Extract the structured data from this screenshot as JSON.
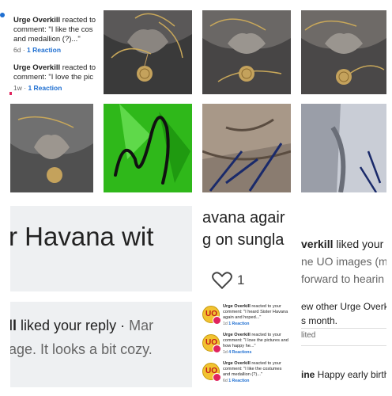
{
  "notif_top": [
    {
      "name": "Urge Overkill",
      "text": " reacted to your comment: \"I like the costumes and medallion (?)...\"",
      "line1": " reacted to",
      "line2": "comment: \"I like the cos",
      "line3": "and medallion (?)...\"",
      "age": "6d",
      "reactions": "1 Reaction"
    },
    {
      "name": "Urge Overkill",
      "line1": " reacted to",
      "line2": "comment: \"I love the pic",
      "age": "1w",
      "reactions": "1 Reaction"
    }
  ],
  "tile_havana": {
    "text": "r Havana wit"
  },
  "tile_liked_reply": {
    "line1_bold": "ll",
    "line1": " liked your reply · ",
    "line1_grey": "Mar",
    "line2": "age. It looks a bit cozy."
  },
  "tile_sungla": {
    "line1": "avana agair",
    "line2": "g on sungla",
    "likes": "1"
  },
  "tile_right_mid": {
    "line1_bold": "verkill",
    "line1": " liked your",
    "line2": "ne UO images (m",
    "line3": "forward to hearin"
  },
  "tile_right_low": {
    "line1": "ew other Urge Overk",
    "line2": "s month.",
    "line3": "lited",
    "line4_bold": "ine",
    "line4": " Happy early birth"
  },
  "mini_notifs": [
    {
      "name": "Urge Overkill",
      "text1": " reacted to your",
      "text2": "comment: \"I heard Sister Havana",
      "text3": "again and hoped...\"",
      "age": "1d",
      "reactions": "1 Reaction"
    },
    {
      "name": "Urge Overkill",
      "text1": " reacted to your",
      "text2": "comment: \"I love the pictures and",
      "text3": "how happy he...\"",
      "age": "1d",
      "reactions": "4 Reactions"
    },
    {
      "name": "Urge Overkill",
      "text1": " reacted to your",
      "text2": "comment: \"I like the costumes",
      "text3": "and medallion (?)...\"",
      "age": "6d",
      "reactions": "1 Reaction"
    }
  ],
  "avatar_letters": "UO",
  "colors": {
    "link_blue": "#1f6fd1",
    "heart_red": "#e0245e",
    "avatar_yellow": "#f2c230",
    "green": "#2fb81a"
  },
  "icons": [
    "heart-outline-icon",
    "medallion-photo",
    "avatar-logo"
  ]
}
